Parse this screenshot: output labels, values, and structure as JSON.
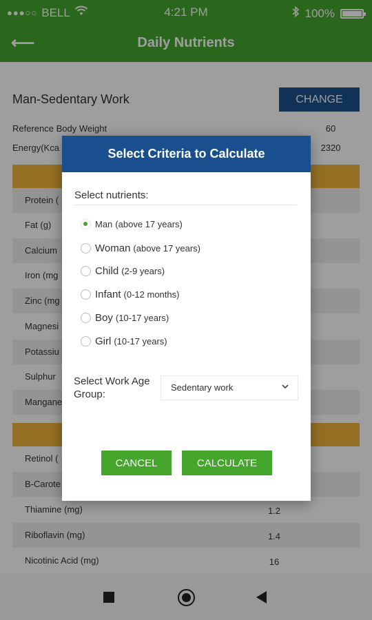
{
  "status_bar": {
    "signal_dots": "●●●○○",
    "carrier": "BELL",
    "wifi_icon": "wifi-icon",
    "time": "4:21 PM",
    "bluetooth_icon": "bluetooth-icon",
    "battery": "100%"
  },
  "app_bar": {
    "back_icon": "⟵",
    "title": "Daily Nutrients"
  },
  "profile": {
    "label": "Man-Sedentary Work",
    "change_button": "CHANGE"
  },
  "reference": {
    "body_weight_label": "Reference Body Weight",
    "body_weight_value": "60",
    "energy_label": "Energy(Kca",
    "energy_value": "2320"
  },
  "nutrients_section1": [
    {
      "label": "Protein (",
      "value": ""
    },
    {
      "label": "Fat (g)",
      "value": ""
    },
    {
      "label": "Calcium",
      "value": ""
    },
    {
      "label": "Iron (mg",
      "value": ""
    },
    {
      "label": "Zinc (mg",
      "value": ""
    },
    {
      "label": "Magnesi",
      "value": ""
    },
    {
      "label": "Potassiu",
      "value": ""
    },
    {
      "label": "Sulphur",
      "value": ""
    },
    {
      "label": "Mangane",
      "value": ""
    }
  ],
  "nutrients_section2": [
    {
      "label": "Retinol (",
      "value": ""
    },
    {
      "label": "B-Carote",
      "value": ""
    },
    {
      "label": "Thiamine (mg)",
      "value": "1.2"
    },
    {
      "label": "Riboflavin (mg)",
      "value": "1.4"
    },
    {
      "label": "Nicotinic Acid (mg)",
      "value": "16"
    }
  ],
  "dialog": {
    "title": "Select Criteria to Calculate",
    "nutrients_label": "Select nutrients:",
    "options": [
      {
        "main": "Man",
        "sub": "(above 17 years)",
        "checked": true
      },
      {
        "main": "Woman",
        "sub": "(above 17 years)",
        "checked": false
      },
      {
        "main": "Child",
        "sub": "(2-9 years)",
        "checked": false
      },
      {
        "main": "Infant",
        "sub": "(0-12 months)",
        "checked": false
      },
      {
        "main": "Boy",
        "sub": "(10-17 years)",
        "checked": false
      },
      {
        "main": "Girl",
        "sub": "(10-17 years)",
        "checked": false
      }
    ],
    "work_label": "Select Work Age Group:",
    "work_value": "Sedentary work",
    "cancel_label": "CANCEL",
    "calculate_label": "CALCULATE"
  },
  "colors": {
    "primary_green": "#45a52c",
    "dialog_blue": "#1a4f8f",
    "section_orange": "#f0b43a"
  }
}
